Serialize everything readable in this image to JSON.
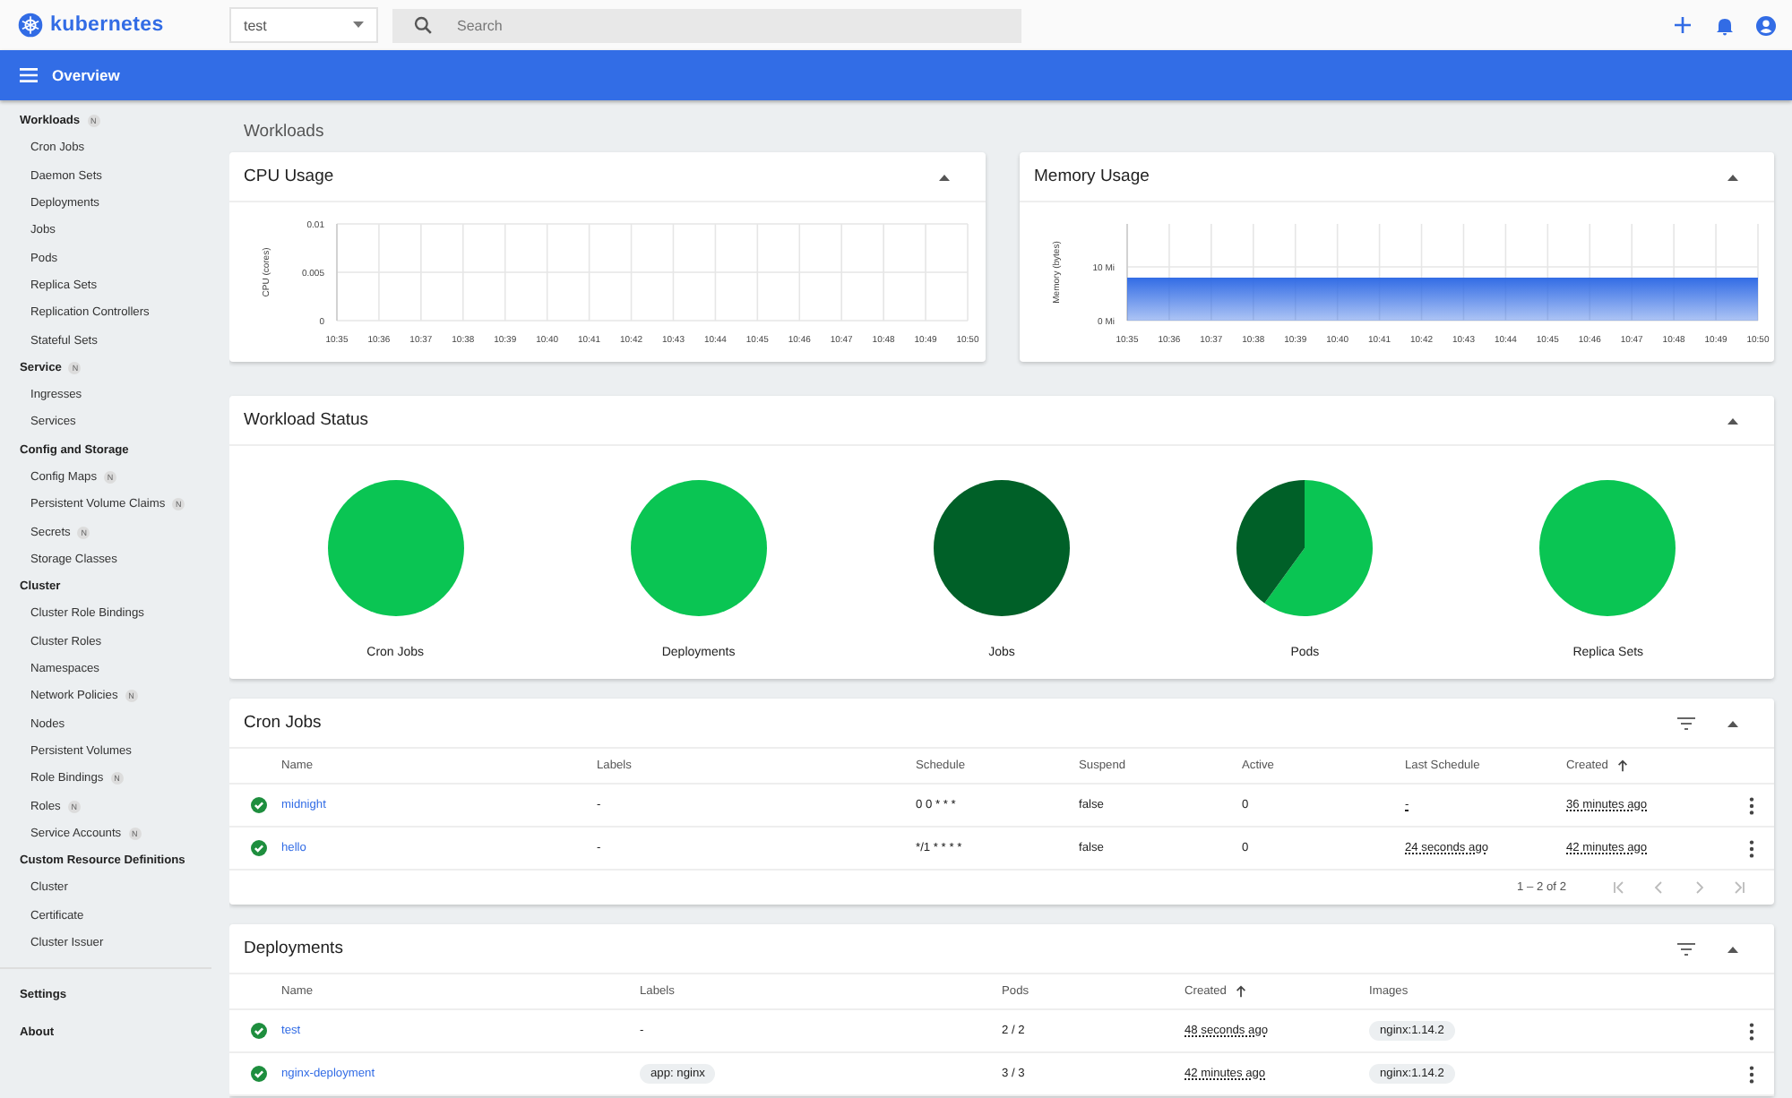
{
  "header": {
    "logo": "kubernetes",
    "namespace": "test",
    "search": {
      "placeholder": "Search"
    }
  },
  "toolbar": {
    "title": "Overview"
  },
  "sidebar": {
    "sections": [
      {
        "title": "Workloads",
        "badge": "N",
        "items": [
          {
            "label": "Cron Jobs"
          },
          {
            "label": "Daemon Sets"
          },
          {
            "label": "Deployments"
          },
          {
            "label": "Jobs"
          },
          {
            "label": "Pods"
          },
          {
            "label": "Replica Sets"
          },
          {
            "label": "Replication Controllers"
          },
          {
            "label": "Stateful Sets"
          }
        ]
      },
      {
        "title": "Service",
        "badge": "N",
        "items": [
          {
            "label": "Ingresses"
          },
          {
            "label": "Services"
          }
        ]
      },
      {
        "title": "Config and Storage",
        "items": [
          {
            "label": "Config Maps",
            "badge": "N"
          },
          {
            "label": "Persistent Volume Claims",
            "badge": "N"
          },
          {
            "label": "Secrets",
            "badge": "N"
          },
          {
            "label": "Storage Classes"
          }
        ]
      },
      {
        "title": "Cluster",
        "items": [
          {
            "label": "Cluster Role Bindings"
          },
          {
            "label": "Cluster Roles"
          },
          {
            "label": "Namespaces"
          },
          {
            "label": "Network Policies",
            "badge": "N"
          },
          {
            "label": "Nodes"
          },
          {
            "label": "Persistent Volumes"
          },
          {
            "label": "Role Bindings",
            "badge": "N"
          },
          {
            "label": "Roles",
            "badge": "N"
          },
          {
            "label": "Service Accounts",
            "badge": "N"
          }
        ]
      },
      {
        "title": "Custom Resource Definitions",
        "items": [
          {
            "label": "Cluster"
          },
          {
            "label": "Certificate"
          },
          {
            "label": "Cluster Issuer"
          }
        ]
      }
    ],
    "footer": [
      {
        "label": "Settings"
      },
      {
        "label": "About"
      }
    ]
  },
  "page_title": "Workloads",
  "cpu_card": {
    "title": "CPU Usage",
    "expanded": true,
    "chart_data": {
      "type": "line",
      "grid": true,
      "ylabel": "CPU (cores)",
      "categories": [
        "10:35",
        "10:36",
        "10:37",
        "10:38",
        "10:39",
        "10:40",
        "10:41",
        "10:42",
        "10:43",
        "10:44",
        "10:45",
        "10:46",
        "10:47",
        "10:48",
        "10:49",
        "10:50"
      ],
      "ylim": [
        0,
        0.01
      ],
      "yticks": [
        {
          "value": 0,
          "label": "0"
        },
        {
          "value": 0.005,
          "label": "0.005"
        },
        {
          "value": 0.01,
          "label": "0.01"
        }
      ]
    }
  },
  "memory_card": {
    "title": "Memory Usage",
    "expanded": true,
    "chart_data": {
      "type": "area",
      "grid": true,
      "ylabel": "Memory (bytes)",
      "categories": [
        "10:35",
        "10:36",
        "10:37",
        "10:38",
        "10:39",
        "10:40",
        "10:41",
        "10:42",
        "10:43",
        "10:44",
        "10:45",
        "10:46",
        "10:47",
        "10:48",
        "10:49",
        "10:50"
      ],
      "ylim": [
        0,
        18
      ],
      "yticks": [
        {
          "value": 0,
          "label": "0 Mi"
        },
        {
          "value": 10,
          "label": "10 Mi"
        }
      ],
      "series": [
        {
          "color": "#326ce5",
          "values": [
            8,
            8,
            8,
            8,
            8,
            8,
            8,
            8,
            8,
            8,
            8,
            8,
            8,
            8,
            8,
            8
          ]
        }
      ]
    }
  },
  "workload_status": {
    "title": "Workload Status",
    "expanded": true,
    "items": [
      {
        "label": "Cron Jobs",
        "kind": "running"
      },
      {
        "label": "Deployments",
        "kind": "running"
      },
      {
        "label": "Jobs",
        "kind": "succeeded"
      },
      {
        "label": "Pods",
        "kind": "mixed"
      },
      {
        "label": "Replica Sets",
        "kind": "running"
      }
    ]
  },
  "cron_jobs": {
    "title": "Cron Jobs",
    "expanded": true,
    "columns": [
      {
        "label": "Name",
        "sorted": false
      },
      {
        "label": "Labels",
        "sorted": false
      },
      {
        "label": "Schedule",
        "sorted": false
      },
      {
        "label": "Suspend",
        "sorted": false
      },
      {
        "label": "Active",
        "sorted": false
      },
      {
        "label": "Last Schedule",
        "sorted": false
      },
      {
        "label": "Created",
        "sorted": true
      }
    ],
    "rows": [
      {
        "name": "midnight",
        "labels": "-",
        "schedule": "0 0 * * *",
        "suspend": "false",
        "active": "0",
        "last_schedule": "-",
        "created": "36 minutes ago"
      },
      {
        "name": "hello",
        "labels": "-",
        "schedule": "*/1 * * * *",
        "suspend": "false",
        "active": "0",
        "last_schedule": "24 seconds ago",
        "created": "42 minutes ago"
      }
    ],
    "pager": {
      "range": "1 – 2 of 2",
      "buttons": [
        {
          "kind": "first",
          "disabled": true
        },
        {
          "kind": "prev",
          "disabled": true
        },
        {
          "kind": "next",
          "disabled": true
        },
        {
          "kind": "last",
          "disabled": true
        }
      ]
    }
  },
  "deployments": {
    "title": "Deployments",
    "expanded": true,
    "columns": [
      {
        "label": "Name",
        "sorted": false
      },
      {
        "label": "Labels",
        "sorted": false
      },
      {
        "label": "Pods",
        "sorted": false
      },
      {
        "label": "Created",
        "sorted": true
      },
      {
        "label": "Images",
        "sorted": false
      }
    ],
    "rows": [
      {
        "name": "test",
        "labels": "-",
        "pods": "2 / 2",
        "created": "48 seconds ago",
        "images": [
          "nginx:1.14.2"
        ]
      },
      {
        "name": "nginx-deployment",
        "labels": [
          "app: nginx"
        ],
        "pods": "3 / 3",
        "created": "42 minutes ago",
        "images": [
          "nginx:1.14.2"
        ]
      }
    ]
  }
}
